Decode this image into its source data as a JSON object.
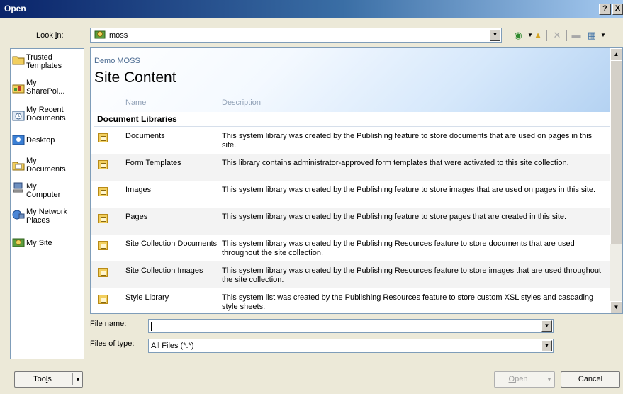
{
  "window": {
    "title": "Open",
    "help_label": "?",
    "close_label": "X"
  },
  "lookin": {
    "label": "Look in:",
    "value": "moss"
  },
  "toolbar": [
    "back-icon",
    "up-folder-icon",
    "delete-icon",
    "new-folder-icon",
    "views-icon"
  ],
  "places": [
    {
      "label": "Trusted\nTemplates",
      "icon": "folder-icon"
    },
    {
      "label": "My\nSharePoi...",
      "icon": "sharepoint-icon"
    },
    {
      "label": "My Recent\nDocuments",
      "icon": "recent-icon"
    },
    {
      "label": "Desktop",
      "icon": "desktop-icon"
    },
    {
      "label": "My\nDocuments",
      "icon": "documents-icon"
    },
    {
      "label": "My\nComputer",
      "icon": "computer-icon"
    },
    {
      "label": "My Network\nPlaces",
      "icon": "network-icon"
    },
    {
      "label": "My Site",
      "icon": "site-icon"
    }
  ],
  "site": {
    "name": "Demo MOSS",
    "title": "Site Content",
    "col_name": "Name",
    "col_desc": "Description",
    "section": "Document Libraries",
    "rows": [
      {
        "name": "Documents",
        "desc": "This system library was created by the Publishing feature to store documents that are used on pages in this site."
      },
      {
        "name": "Form Templates",
        "desc": "This library contains administrator-approved form templates that were activated to this site collection."
      },
      {
        "name": "Images",
        "desc": "This system library was created by the Publishing feature to store images that are used on pages in this site."
      },
      {
        "name": "Pages",
        "desc": "This system library was created by the Publishing feature to store pages that are created in this site."
      },
      {
        "name": "Site Collection Documents",
        "desc": "This system library was created by the Publishing Resources feature to store documents that are used throughout the site collection."
      },
      {
        "name": "Site Collection Images",
        "desc": "This system library was created by the Publishing Resources feature to store images that are used throughout the site collection."
      },
      {
        "name": "Style Library",
        "desc": "This system list was created by the Publishing Resources feature to store custom XSL styles and cascading style sheets."
      }
    ]
  },
  "filename": {
    "label": "File name:",
    "value": ""
  },
  "filetype": {
    "label": "Files of type:",
    "value": "All Files (*.*)"
  },
  "buttons": {
    "tools": "Tools",
    "open": "Open",
    "cancel": "Cancel"
  }
}
